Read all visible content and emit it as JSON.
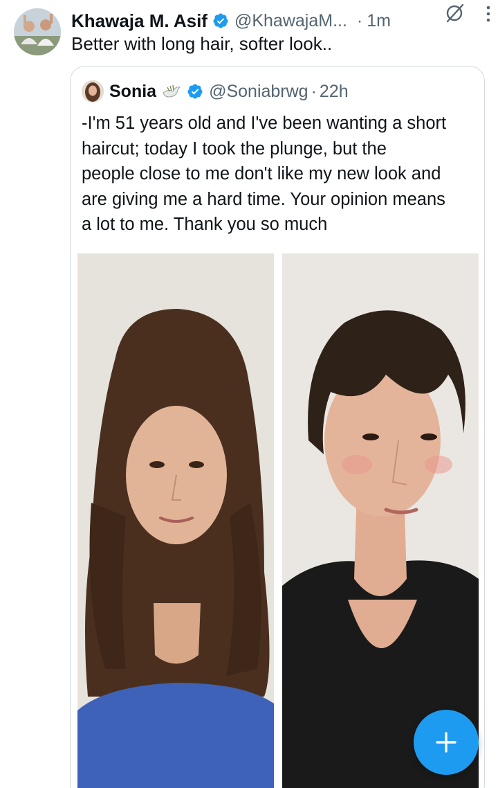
{
  "tweet": {
    "author_name": "Khawaja M. Asif",
    "author_handle": "@KhawajaM...",
    "separator": "·",
    "time": "1m",
    "text": "Better with long hair, softer look..",
    "avatar_icon": "profile-photo-group",
    "verified_icon": "verified-badge-icon",
    "grok_icon": "grok-icon",
    "more_icon": "more-vertical-icon"
  },
  "quoted_tweet": {
    "author_name": "Sonia",
    "emoji_icon": "dove-icon",
    "author_handle": "@Soniabrwg",
    "separator": "·",
    "time": "22h",
    "text_lines": [
      "-I'm 51 years old and I've been wanting a short",
      "haircut; today I took the plunge, but the",
      "people close to me don't like my new look and",
      "are giving me a hard time. Your opinion means",
      "a lot to me. Thank you so much"
    ],
    "media": [
      {
        "description_icon": "photo-long-hair"
      },
      {
        "description_icon": "photo-short-hair"
      }
    ]
  },
  "compose_button": {
    "icon": "plus-icon"
  },
  "colors": {
    "verified": "#1d9bf0",
    "fab": "#1d9bf0",
    "secondary_text": "#536471",
    "border": "#cfd9de"
  }
}
